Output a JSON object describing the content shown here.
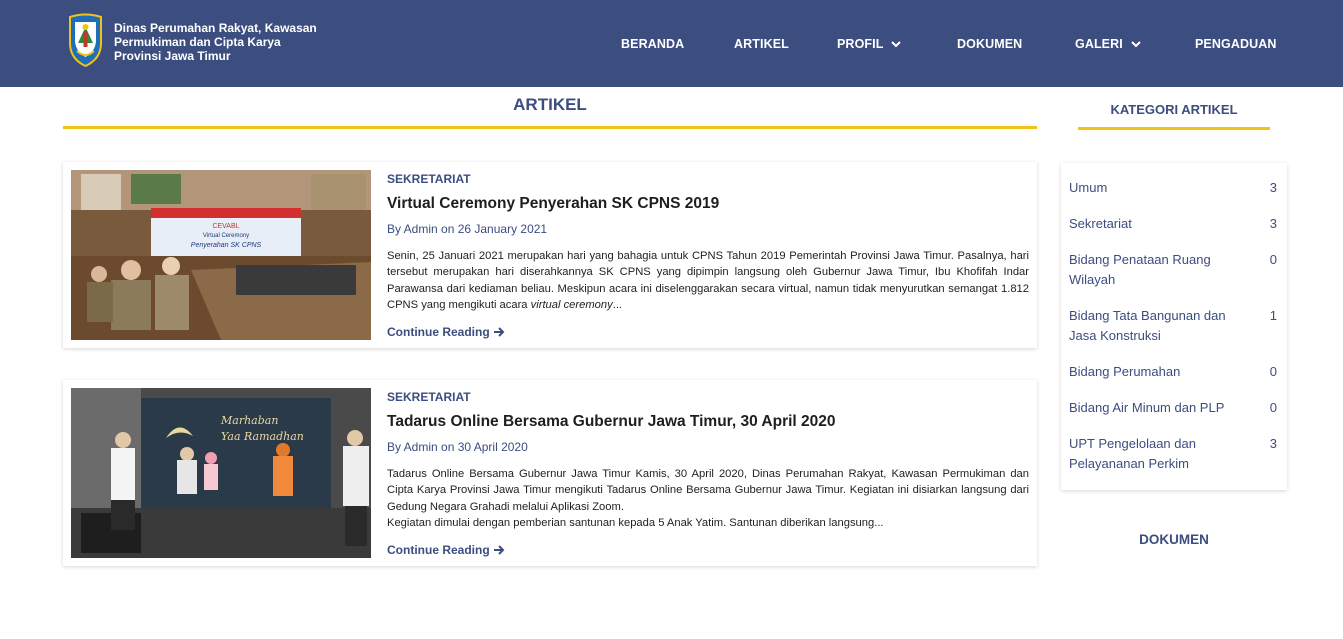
{
  "header": {
    "brand": [
      "Dinas Perumahan Rakyat, Kawasan",
      "Permukiman dan Cipta Karya",
      "Provinsi Jawa Timur"
    ],
    "nav": [
      {
        "label": "BERANDA"
      },
      {
        "label": "ARTIKEL"
      },
      {
        "label": "PROFIL",
        "has_dropdown": true
      },
      {
        "label": "DOKUMEN"
      },
      {
        "label": "GALERI",
        "has_dropdown": true
      },
      {
        "label": "PENGADUAN"
      }
    ]
  },
  "main": {
    "title": "ARTIKEL",
    "articles": [
      {
        "category": "SEKRETARIAT",
        "title": "Virtual Ceremony Penyerahan SK CPNS 2019",
        "meta": "By Admin on 26 January 2021",
        "excerpt": "Senin, 25 Januari 2021 merupakan hari yang bahagia untuk CPNS Tahun 2019 Pemerintah Provinsi Jawa Timur. Pasalnya, hari tersebut merupakan hari diserahkannya SK CPNS yang dipimpin langsung oleh Gubernur Jawa Timur, Ibu Khofifah Indar Parawansa dari kediaman beliau. Meskipun acara ini diselenggarakan secara virtual, namun tidak menyurutkan semangat 1.812 CPNS yang mengikuti acara ",
        "excerpt_em": "virtual ceremony",
        "excerpt_tail": "...",
        "more": "Continue Reading",
        "banner": [
          "CEVABL",
          "Virtual Ceremony",
          "Penyerahan SK CPNS"
        ]
      },
      {
        "category": "SEKRETARIAT",
        "title": "Tadarus Online Bersama Gubernur Jawa Timur, 30 April 2020",
        "meta": "By Admin on 30 April 2020",
        "excerpt": "Tadarus Online Bersama Gubernur Jawa Timur Kamis, 30 April 2020, Dinas Perumahan Rakyat, Kawasan Permukiman dan Cipta Karya Provinsi Jawa Timur mengikuti Tadarus Online Bersama Gubernur Jawa Timur. Kegiatan ini disiarkan langsung dari Gedung Negara Grahadi melalui Aplikasi Zoom.",
        "excerpt2": "Kegiatan dimulai dengan pemberian santunan kepada 5 Anak Yatim. Santunan diberikan langsung...",
        "more": "Continue Reading",
        "banner": [
          "Marhaban",
          "Yaa Ramadhan"
        ]
      }
    ]
  },
  "sidebar": {
    "title": "KATEGORI ARTIKEL",
    "categories": [
      {
        "name": "Umum",
        "count": "3"
      },
      {
        "name": "Sekretariat",
        "count": "3"
      },
      {
        "name": "Bidang Penataan Ruang Wilayah",
        "count": "0"
      },
      {
        "name": "Bidang Tata Bangunan dan Jasa Konstruksi",
        "count": "1"
      },
      {
        "name": "Bidang Perumahan",
        "count": "0"
      },
      {
        "name": "Bidang Air Minum dan PLP",
        "count": "0"
      },
      {
        "name": "UPT Pengelolaan dan Pelayananan Perkim",
        "count": "3"
      }
    ],
    "documents_title": "DOKUMEN"
  },
  "colors": {
    "navbar": "#3c4d80",
    "accent": "#f2c21b",
    "link": "#3c4d80"
  }
}
